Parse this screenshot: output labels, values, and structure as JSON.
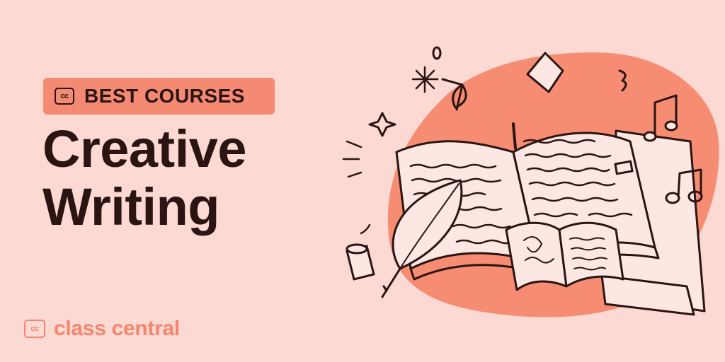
{
  "badge": {
    "icon": "cc-icon",
    "icon_text": "cc",
    "label": "BEST COURSES"
  },
  "title": {
    "line1": "Creative",
    "line2": "Writing"
  },
  "brand": {
    "icon": "cc-icon",
    "icon_text": "cc",
    "name": "class central"
  },
  "illustration": {
    "icon": "open-book-with-quill-and-music-notes"
  },
  "colors": {
    "background": "#fcd9d3",
    "accent": "#f48a72",
    "blob": "#f68c72",
    "ink": "#2b1513",
    "brand": "#f4866e"
  }
}
